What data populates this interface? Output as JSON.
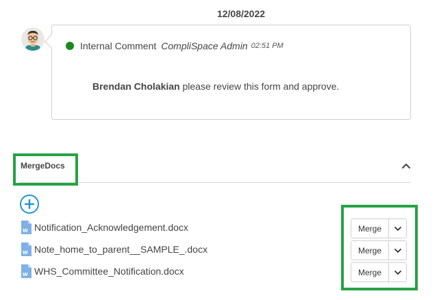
{
  "comment": {
    "date": "12/08/2022",
    "type": "Internal Comment",
    "author": "CompliSpace Admin",
    "time": "02:51 PM",
    "mention": "Brendan Cholakian",
    "message": " please review this form and approve.",
    "status_color": "#1a8a1a"
  },
  "mergedocs": {
    "title": "MergeDocs",
    "documents": [
      {
        "name": "Notification_Acknowledgement.docx",
        "action_label": "Merge"
      },
      {
        "name": "Note_home_to_parent__SAMPLE_.docx",
        "action_label": "Merge"
      },
      {
        "name": "WHS_Committee_Notification.docx",
        "action_label": "Merge"
      }
    ]
  },
  "colors": {
    "accent": "#2196d3",
    "highlight": "#25a244",
    "word_icon": "#7fb0e6"
  }
}
